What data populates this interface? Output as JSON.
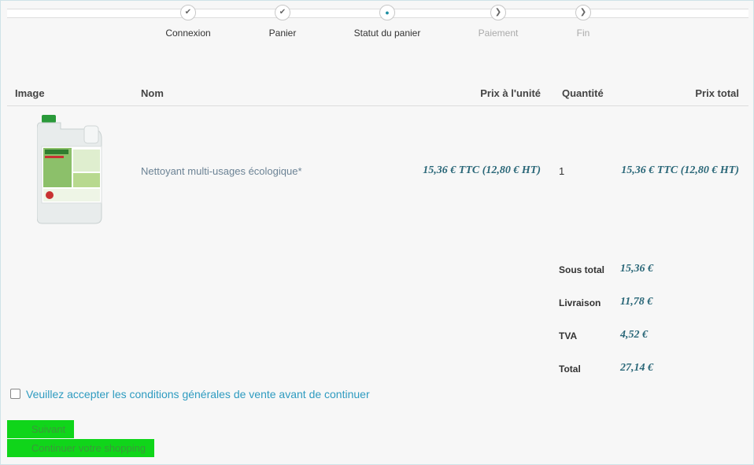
{
  "stepper": {
    "steps": [
      {
        "label": "Connexion",
        "state": "done",
        "icon": "check-icon"
      },
      {
        "label": "Panier",
        "state": "done",
        "icon": "check-icon"
      },
      {
        "label": "Statut du panier",
        "state": "current",
        "icon": "dot-icon"
      },
      {
        "label": "Paiement",
        "state": "future",
        "icon": "chevron-right-icon"
      },
      {
        "label": "Fin",
        "state": "future",
        "icon": "chevron-right-icon"
      }
    ]
  },
  "cart": {
    "headers": {
      "image": "Image",
      "name": "Nom",
      "unit_price": "Prix à l'unité",
      "quantity": "Quantité",
      "total_price": "Prix total"
    },
    "items": [
      {
        "image_alt": "detergent-jug-image",
        "name": "Nettoyant multi-usages écologique*",
        "unit_price": "15,36 € TTC (12,80 € HT)",
        "quantity": "1",
        "total_price": "15,36 € TTC (12,80 € HT)"
      }
    ]
  },
  "totals": {
    "subtotal_label": "Sous total",
    "subtotal_value": "15,36 €",
    "shipping_label": "Livraison",
    "shipping_value": "11,78 €",
    "vat_label": "TVA",
    "vat_value": "4,52 €",
    "total_label": "Total",
    "total_value": "27,14 €"
  },
  "terms": {
    "checked": false,
    "label": "Veuillez accepter les conditions générales de vente avant de continuer"
  },
  "buttons": {
    "next": "Suivant",
    "continue_shopping": "Continuer votre shopping"
  },
  "colors": {
    "accent": "#2e9bc0",
    "price": "#2a6778",
    "button": "#10d51a"
  }
}
